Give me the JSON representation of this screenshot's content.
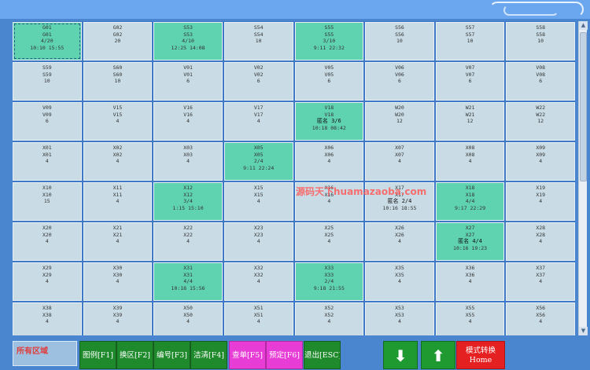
{
  "colors": {
    "background": "#4a86d0",
    "cell_empty": "#c9dce5",
    "cell_occupied": "#5fd2b0",
    "function_button": "#1e8a2c",
    "highlight_button": "#e83cd6",
    "mode_button": "#e52020"
  },
  "rooms": [
    {
      "lines": [
        "G01",
        "G01",
        "4/20",
        "10:10 15:55"
      ],
      "status": "occupied",
      "selected": true
    },
    {
      "lines": [
        "G02",
        "G02",
        "20"
      ],
      "status": "empty"
    },
    {
      "lines": [
        "S53",
        "S53",
        "4/10",
        "12:25 14:08"
      ],
      "status": "occupied"
    },
    {
      "lines": [
        "S54",
        "S54",
        "10"
      ],
      "status": "empty"
    },
    {
      "lines": [
        "S55",
        "S55",
        "3/10",
        "9:11 22:32"
      ],
      "status": "occupied"
    },
    {
      "lines": [
        "S56",
        "S56",
        "10"
      ],
      "status": "empty"
    },
    {
      "lines": [
        "S57",
        "S57",
        "10"
      ],
      "status": "empty"
    },
    {
      "lines": [
        "S58",
        "S58",
        "10"
      ],
      "status": "empty"
    },
    {
      "lines": [
        "S59",
        "S59",
        "10"
      ],
      "status": "empty"
    },
    {
      "lines": [
        "S60",
        "S60",
        "10"
      ],
      "status": "empty"
    },
    {
      "lines": [
        "V01",
        "V01",
        "6"
      ],
      "status": "empty"
    },
    {
      "lines": [
        "V02",
        "V02",
        "6"
      ],
      "status": "empty"
    },
    {
      "lines": [
        "V05",
        "V05",
        "6"
      ],
      "status": "empty"
    },
    {
      "lines": [
        "V06",
        "V06",
        "6"
      ],
      "status": "empty"
    },
    {
      "lines": [
        "V07",
        "V07",
        "6"
      ],
      "status": "empty"
    },
    {
      "lines": [
        "V08",
        "V08",
        "6"
      ],
      "status": "empty"
    },
    {
      "lines": [
        "V09",
        "V09",
        "6"
      ],
      "status": "empty"
    },
    {
      "lines": [
        "V15",
        "V15",
        "4"
      ],
      "status": "empty"
    },
    {
      "lines": [
        "V16",
        "V16",
        "4"
      ],
      "status": "empty"
    },
    {
      "lines": [
        "V17",
        "V17",
        "4"
      ],
      "status": "empty"
    },
    {
      "lines": [
        "V18",
        "V18",
        "匿名 3/6",
        "10:18 08:42"
      ],
      "status": "occupied"
    },
    {
      "lines": [
        "W20",
        "W20",
        "12"
      ],
      "status": "empty"
    },
    {
      "lines": [
        "W21",
        "W21",
        "12"
      ],
      "status": "empty"
    },
    {
      "lines": [
        "W22",
        "W22",
        "12"
      ],
      "status": "empty"
    },
    {
      "lines": [
        "X01",
        "X01",
        "4"
      ],
      "status": "empty"
    },
    {
      "lines": [
        "X02",
        "X02",
        "4"
      ],
      "status": "empty"
    },
    {
      "lines": [
        "X03",
        "X03",
        "4"
      ],
      "status": "empty"
    },
    {
      "lines": [
        "X05",
        "X05",
        "2/4",
        "9:11 22:24"
      ],
      "status": "occupied"
    },
    {
      "lines": [
        "X06",
        "X06",
        "4"
      ],
      "status": "empty"
    },
    {
      "lines": [
        "X07",
        "X07",
        "4"
      ],
      "status": "empty"
    },
    {
      "lines": [
        "X08",
        "X08",
        "4"
      ],
      "status": "empty"
    },
    {
      "lines": [
        "X09",
        "X09",
        "4"
      ],
      "status": "empty"
    },
    {
      "lines": [
        "X10",
        "X10",
        "15"
      ],
      "status": "empty"
    },
    {
      "lines": [
        "X11",
        "X11",
        "4"
      ],
      "status": "empty"
    },
    {
      "lines": [
        "X12",
        "X12",
        "3/4",
        "1:15 15:10"
      ],
      "status": "occupied"
    },
    {
      "lines": [
        "X15",
        "X15",
        "4"
      ],
      "status": "empty"
    },
    {
      "lines": [
        "X16",
        "X16",
        "4"
      ],
      "status": "empty"
    },
    {
      "lines": [
        "X17",
        "X17",
        "匿名 2/4",
        "10:16 18:55"
      ],
      "status": "empty"
    },
    {
      "lines": [
        "X18",
        "X18",
        "4/4",
        "9:17 22:29"
      ],
      "status": "occupied"
    },
    {
      "lines": [
        "X19",
        "X19",
        "4"
      ],
      "status": "empty"
    },
    {
      "lines": [
        "X20",
        "X20",
        "4"
      ],
      "status": "empty"
    },
    {
      "lines": [
        "X21",
        "X21",
        "4"
      ],
      "status": "empty"
    },
    {
      "lines": [
        "X22",
        "X22",
        "4"
      ],
      "status": "empty"
    },
    {
      "lines": [
        "X23",
        "X23",
        "4"
      ],
      "status": "empty"
    },
    {
      "lines": [
        "X25",
        "X25",
        "4"
      ],
      "status": "empty"
    },
    {
      "lines": [
        "X26",
        "X26",
        "4"
      ],
      "status": "empty"
    },
    {
      "lines": [
        "X27",
        "X27",
        "匿名 4/4",
        "10:16 19:23"
      ],
      "status": "occupied"
    },
    {
      "lines": [
        "X28",
        "X28",
        "4"
      ],
      "status": "empty"
    },
    {
      "lines": [
        "X29",
        "X29",
        "4"
      ],
      "status": "empty"
    },
    {
      "lines": [
        "X30",
        "X30",
        "4"
      ],
      "status": "empty"
    },
    {
      "lines": [
        "X31",
        "X31",
        "4/4",
        "10:18 15:56"
      ],
      "status": "occupied"
    },
    {
      "lines": [
        "X32",
        "X32",
        "4"
      ],
      "status": "empty"
    },
    {
      "lines": [
        "X33",
        "X33",
        "2/4",
        "9:18 21:55"
      ],
      "status": "occupied"
    },
    {
      "lines": [
        "X35",
        "X35",
        "4"
      ],
      "status": "empty"
    },
    {
      "lines": [
        "X36",
        "X36",
        "4"
      ],
      "status": "empty"
    },
    {
      "lines": [
        "X37",
        "X37",
        "4"
      ],
      "status": "empty"
    },
    {
      "lines": [
        "X38",
        "X38",
        "4"
      ],
      "status": "empty"
    },
    {
      "lines": [
        "X39",
        "X39",
        "4"
      ],
      "status": "empty"
    },
    {
      "lines": [
        "X50",
        "X50",
        "4"
      ],
      "status": "empty"
    },
    {
      "lines": [
        "X51",
        "X51",
        "4"
      ],
      "status": "empty"
    },
    {
      "lines": [
        "X52",
        "X52",
        "4"
      ],
      "status": "empty"
    },
    {
      "lines": [
        "X53",
        "X53",
        "4"
      ],
      "status": "empty"
    },
    {
      "lines": [
        "X55",
        "X55",
        "4"
      ],
      "status": "empty"
    },
    {
      "lines": [
        "X56",
        "X56",
        "4"
      ],
      "status": "empty"
    }
  ],
  "toolbar": {
    "area_label": "所有区域",
    "buttons": [
      {
        "name": "legend-button",
        "label": "图例[F1]"
      },
      {
        "name": "switch-area-button",
        "label": "换区[F2]"
      },
      {
        "name": "number-button",
        "label": "编号[F3]"
      },
      {
        "name": "clean-button",
        "label": "洁清[F4]"
      },
      {
        "name": "check-order-button",
        "label": "查单[F5]"
      },
      {
        "name": "reserve-button",
        "label": "预定[F6]"
      },
      {
        "name": "exit-button",
        "label": "退出[ESC]"
      }
    ],
    "down_arrow": "⬇",
    "up_arrow": "⬆",
    "mode_line1": "模式转换",
    "mode_line2": "Home"
  },
  "scroll": {
    "up": "▲",
    "down": "▼"
  },
  "watermark": "源码天下huamazaoba.com"
}
